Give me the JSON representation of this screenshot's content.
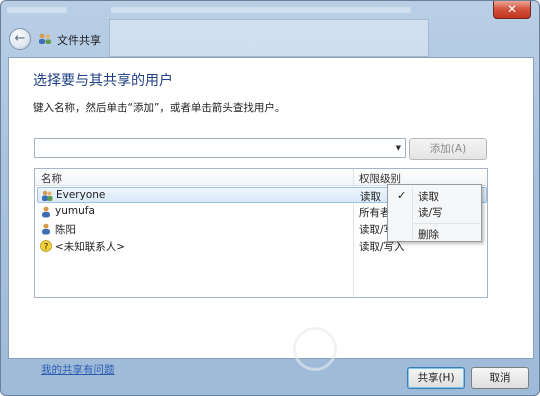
{
  "window": {
    "title": "文件共享",
    "close_glyph": "✕",
    "back_glyph": "←"
  },
  "main": {
    "heading": "选择要与其共享的用户",
    "instruction": "键入名称，然后单击“添加”，或者单击箭头查找用户。",
    "name_input": {
      "value": "",
      "placeholder": ""
    },
    "add_button": "添加(A)",
    "help_link": "我的共享有问题"
  },
  "list": {
    "columns": [
      "名称",
      "权限级别"
    ],
    "rows": [
      {
        "name": "Everyone",
        "permission": "读取",
        "icon": "group-icon",
        "selected": true
      },
      {
        "name": "yumufa",
        "permission": "所有者",
        "icon": "user-icon",
        "selected": false
      },
      {
        "name": "陈阳",
        "permission": "读取/写入",
        "icon": "user-icon",
        "selected": false
      },
      {
        "name": "<未知联系人>",
        "permission": "读取/写入",
        "icon": "unknown-user-icon",
        "selected": false
      }
    ]
  },
  "permission_menu": {
    "items": [
      "读取",
      "读/写",
      "删除"
    ],
    "checked": "读取"
  },
  "buttons": {
    "share": "共享(H)",
    "cancel": "取消"
  },
  "colors": {
    "heading": "#1f3f86",
    "link": "#2a5db0",
    "selection": "#d8e8f8"
  }
}
